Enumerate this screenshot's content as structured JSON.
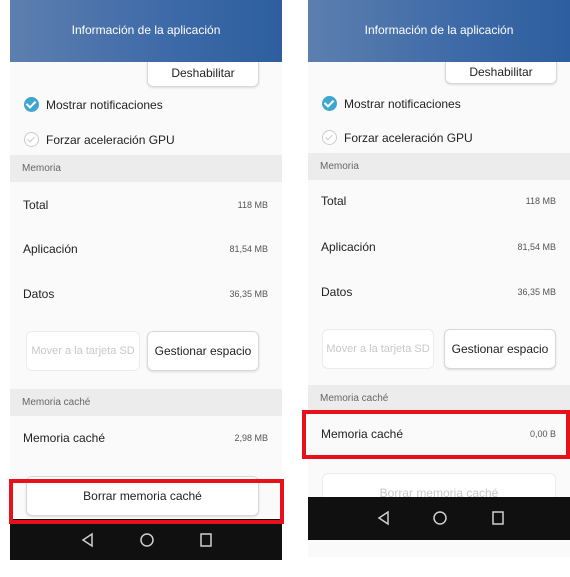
{
  "left": {
    "title": "Información de la aplicación",
    "disable_button": "Deshabilitar",
    "checks": [
      {
        "label": "Mostrar notificaciones",
        "checked": true
      },
      {
        "label": "Forzar aceleración GPU",
        "checked": false
      }
    ],
    "memory_header": "Memoria",
    "memory_rows": [
      {
        "label": "Total",
        "value": "118 MB"
      },
      {
        "label": "Aplicación",
        "value": "81,54 MB"
      },
      {
        "label": "Datos",
        "value": "36,35 MB"
      }
    ],
    "move_sd_button": "Mover a la tarjeta SD",
    "manage_space_button": "Gestionar espacio",
    "cache_header": "Memoria caché",
    "cache_row": {
      "label": "Memoria caché",
      "value": "2,98 MB"
    },
    "clear_cache_button": "Borrar memoria caché"
  },
  "right": {
    "title": "Información de la aplicación",
    "disable_button": "Deshabilitar",
    "checks": [
      {
        "label": "Mostrar notificaciones",
        "checked": true
      },
      {
        "label": "Forzar aceleración GPU",
        "checked": false
      }
    ],
    "memory_header": "Memoria",
    "memory_rows": [
      {
        "label": "Total",
        "value": "118 MB"
      },
      {
        "label": "Aplicación",
        "value": "81,54 MB"
      },
      {
        "label": "Datos",
        "value": "36,35 MB"
      }
    ],
    "move_sd_button": "Mover a la tarjeta SD",
    "manage_space_button": "Gestionar espacio",
    "cache_header": "Memoria caché",
    "cache_row": {
      "label": "Memoria caché",
      "value": "0,00 B"
    },
    "clear_cache_button": "Borrar memoria caché"
  },
  "navbar_icons": [
    "back-icon",
    "home-icon",
    "recents-icon"
  ],
  "colors": {
    "titlebar": "#3f6ba8",
    "checkbox_on": "#3fa6d0",
    "highlight": "#e8101b",
    "navbar": "#101010"
  }
}
